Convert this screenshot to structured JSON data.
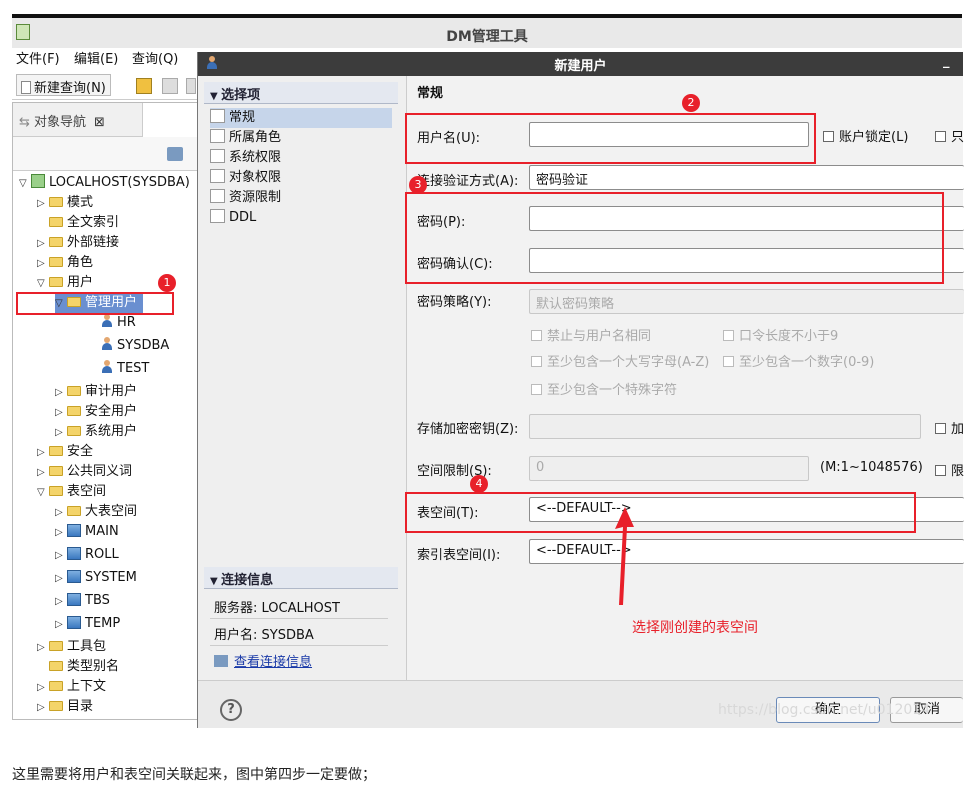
{
  "app": {
    "title": "DM管理工具"
  },
  "menu": {
    "file": "文件(F)",
    "edit": "编辑(E)",
    "query": "查询(Q)"
  },
  "toolbar": {
    "new_query": "新建查询(N)"
  },
  "navigator": {
    "tab_label": "对象导航",
    "tree": [
      {
        "label": "LOCALHOST(SYSDBA)",
        "level": 0,
        "expander": "▽",
        "icon": "server-icon"
      },
      {
        "label": "模式",
        "level": 1,
        "expander": "▷",
        "icon": "folder-icon"
      },
      {
        "label": "全文索引",
        "level": 1,
        "expander": "",
        "icon": "folder-icon"
      },
      {
        "label": "外部链接",
        "level": 1,
        "expander": "▷",
        "icon": "folder-icon"
      },
      {
        "label": "角色",
        "level": 1,
        "expander": "▷",
        "icon": "folder-icon"
      },
      {
        "label": "用户",
        "level": 1,
        "expander": "▽",
        "icon": "folder-icon"
      },
      {
        "label": "管理用户",
        "level": 2,
        "expander": "▽",
        "icon": "folder-icon"
      },
      {
        "label": "HR",
        "level": 3,
        "expander": "",
        "icon": "user-icon"
      },
      {
        "label": "SYSDBA",
        "level": 3,
        "expander": "",
        "icon": "user-icon"
      },
      {
        "label": "TEST",
        "level": 3,
        "expander": "",
        "icon": "user-icon"
      },
      {
        "label": "审计用户",
        "level": 2,
        "expander": "▷",
        "icon": "folder-icon"
      },
      {
        "label": "安全用户",
        "level": 2,
        "expander": "▷",
        "icon": "folder-icon"
      },
      {
        "label": "系统用户",
        "level": 2,
        "expander": "▷",
        "icon": "folder-icon"
      },
      {
        "label": "安全",
        "level": 1,
        "expander": "▷",
        "icon": "folder-icon"
      },
      {
        "label": "公共同义词",
        "level": 1,
        "expander": "▷",
        "icon": "folder-icon"
      },
      {
        "label": "表空间",
        "level": 1,
        "expander": "▽",
        "icon": "folder-icon"
      },
      {
        "label": "大表空间",
        "level": 2,
        "expander": "▷",
        "icon": "folder-icon"
      },
      {
        "label": "MAIN",
        "level": 2,
        "expander": "▷",
        "icon": "tablespace-icon"
      },
      {
        "label": "ROLL",
        "level": 2,
        "expander": "▷",
        "icon": "tablespace-icon"
      },
      {
        "label": "SYSTEM",
        "level": 2,
        "expander": "▷",
        "icon": "tablespace-icon"
      },
      {
        "label": "TBS",
        "level": 2,
        "expander": "▷",
        "icon": "tablespace-icon"
      },
      {
        "label": "TEMP",
        "level": 2,
        "expander": "▷",
        "icon": "tablespace-icon"
      },
      {
        "label": "工具包",
        "level": 1,
        "expander": "▷",
        "icon": "folder-icon"
      },
      {
        "label": "类型别名",
        "level": 1,
        "expander": "",
        "icon": "folder-icon"
      },
      {
        "label": "上下文",
        "level": 1,
        "expander": "▷",
        "icon": "folder-icon"
      },
      {
        "label": "目录",
        "level": 1,
        "expander": "▷",
        "icon": "folder-icon"
      }
    ]
  },
  "dialog": {
    "title": "新建用户",
    "options_header": "选择项",
    "options": [
      "常规",
      "所属角色",
      "系统权限",
      "对象权限",
      "资源限制",
      "DDL"
    ],
    "connection": {
      "header": "连接信息",
      "server": "服务器: LOCALHOST",
      "user": "用户名: SYSDBA",
      "view_link": "查看连接信息"
    },
    "form": {
      "section_title": "常规",
      "username_label": "用户名(U):",
      "username_value": "",
      "account_lock_label": "账户锁定(L)",
      "readonly_label": "只",
      "auth_label": "连接验证方式(A):",
      "auth_value": "密码验证",
      "password_label": "密码(P):",
      "password_confirm_label": "密码确认(C):",
      "policy_label": "密码策略(Y):",
      "policy_value": "默认密码策略",
      "policy_options": [
        "禁止与用户名相同",
        "口令长度不小于9",
        "至少包含一个大写字母(A-Z)",
        "至少包含一个数字(0-9)",
        "至少包含一个特殊字符"
      ],
      "storage_key_label": "存储加密密钥(Z):",
      "storage_key_extra": "加",
      "space_limit_label": "空间限制(S):",
      "space_limit_value": "0",
      "space_limit_range": "(M:1~1048576)",
      "space_limit_extra": "限",
      "tablespace_label": "表空间(T):",
      "tablespace_value": "<--DEFAULT-->",
      "index_tablespace_label": "索引表空间(I):",
      "index_tablespace_value": "<--DEFAULT-->"
    },
    "buttons": {
      "ok": "确定",
      "cancel": "取消"
    }
  },
  "annotations": {
    "step1": "1",
    "step2": "2",
    "step3": "3",
    "step4": "4",
    "arrow_text": "选择刚创建的表空间",
    "accent_color": "#e8202a"
  },
  "watermark": "https://blog.csdn.net/u012014",
  "caption": "这里需要将用户和表空间关联起来，图中第四步一定要做；"
}
